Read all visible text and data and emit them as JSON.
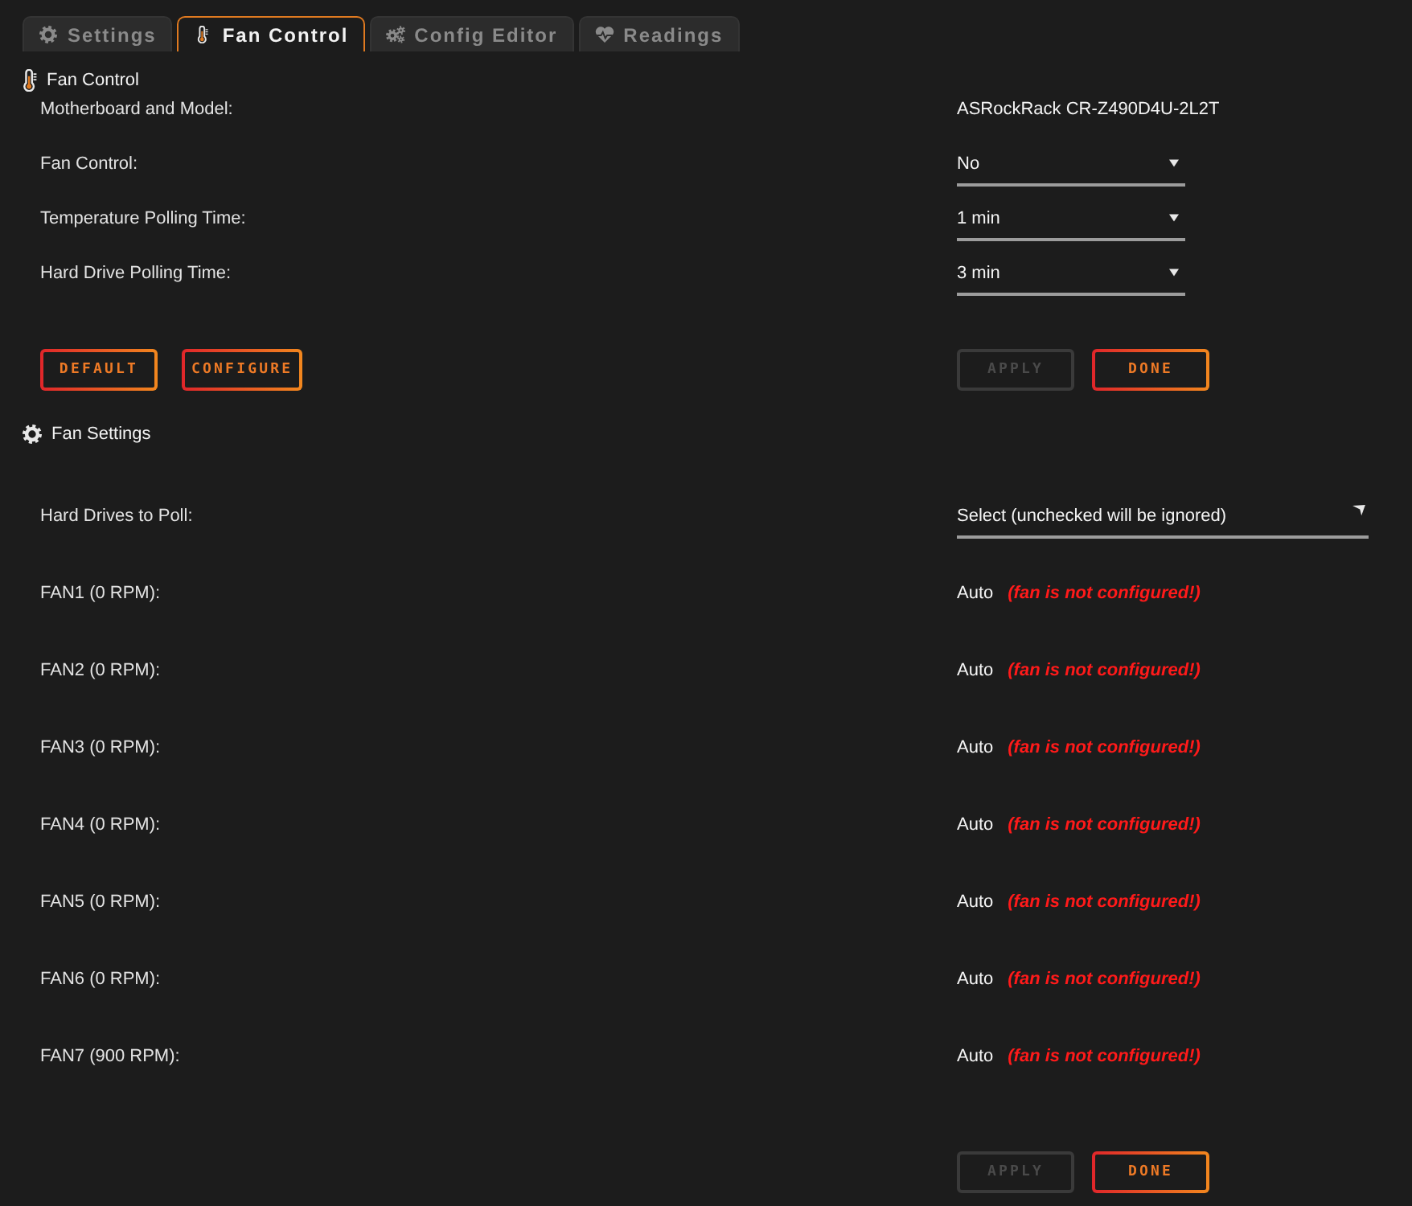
{
  "tabs": [
    {
      "label": "Settings",
      "selected": false
    },
    {
      "label": "Fan Control",
      "selected": true
    },
    {
      "label": "Config Editor",
      "selected": false
    },
    {
      "label": "Readings",
      "selected": false
    }
  ],
  "sections": [
    {
      "title": "Fan Control",
      "fields": [
        {
          "kind": "text",
          "label": "Motherboard and Model:",
          "value": "ASRockRack CR-Z490D4U-2L2T"
        },
        {
          "kind": "select",
          "label": "Fan Control:",
          "value": "No"
        },
        {
          "kind": "select",
          "label": "Temperature Polling Time:",
          "value": "1 min"
        },
        {
          "kind": "select",
          "label": "Hard Drive Polling Time:",
          "value": "3 min"
        }
      ],
      "left_buttons": [
        {
          "label": "DEFAULT",
          "disabled": false
        },
        {
          "label": "CONFIGURE",
          "disabled": false
        }
      ],
      "right_buttons": [
        {
          "label": "APPLY",
          "disabled": true
        },
        {
          "label": "DONE",
          "disabled": false
        }
      ]
    },
    {
      "title": "Fan Settings",
      "fields": [
        {
          "kind": "multiselect",
          "label": "Hard Drives to Poll:",
          "value": "Select (unchecked will be ignored)"
        },
        {
          "kind": "fan",
          "label": "FAN1 (0 RPM):",
          "value": "Auto",
          "warning": "(fan is not configured!)"
        },
        {
          "kind": "fan",
          "label": "FAN2 (0 RPM):",
          "value": "Auto",
          "warning": "(fan is not configured!)"
        },
        {
          "kind": "fan",
          "label": "FAN3 (0 RPM):",
          "value": "Auto",
          "warning": "(fan is not configured!)"
        },
        {
          "kind": "fan",
          "label": "FAN4 (0 RPM):",
          "value": "Auto",
          "warning": "(fan is not configured!)"
        },
        {
          "kind": "fan",
          "label": "FAN5 (0 RPM):",
          "value": "Auto",
          "warning": "(fan is not configured!)"
        },
        {
          "kind": "fan",
          "label": "FAN6 (0 RPM):",
          "value": "Auto",
          "warning": "(fan is not configured!)"
        },
        {
          "kind": "fan",
          "label": "FAN7 (900 RPM):",
          "value": "Auto",
          "warning": "(fan is not configured!)"
        }
      ],
      "right_buttons": [
        {
          "label": "APPLY",
          "disabled": true
        },
        {
          "label": "DONE",
          "disabled": false
        }
      ]
    }
  ]
}
